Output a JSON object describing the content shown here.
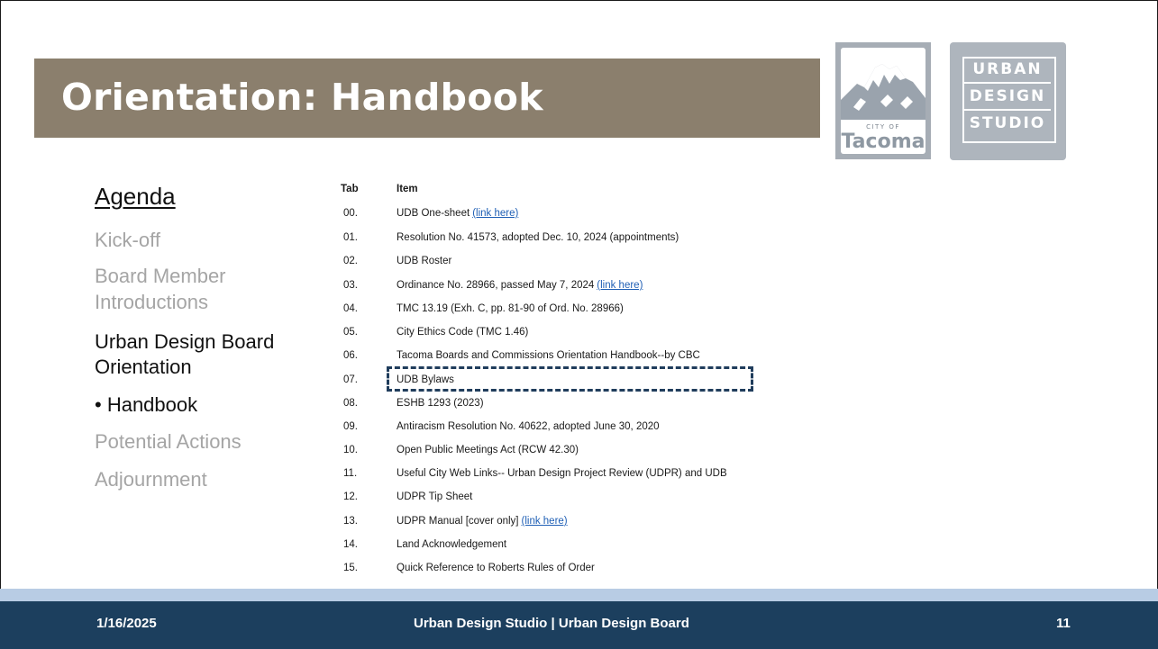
{
  "slide": {
    "title": "Orientation: Handbook",
    "colors": {
      "title_band": "#8b7f6d",
      "footer": "#1c3f5e",
      "footer_stripe": "#b8cce4",
      "link": "#1f5fb5",
      "highlight_box": "#203d5c"
    }
  },
  "logos": {
    "tacoma": {
      "city_text": "CITY OF",
      "name_text": "Tacoma"
    },
    "uds": {
      "line1": "URBAN",
      "line2": "DESIGN",
      "line3": "STUDIO"
    }
  },
  "agenda": {
    "heading": "Agenda",
    "items": [
      {
        "text": "Kick-off",
        "state": "dim"
      },
      {
        "text": "Board Member",
        "state": "dim"
      },
      {
        "text": "Introductions",
        "state": "dim"
      },
      {
        "text": "Urban Design Board",
        "state": "active"
      },
      {
        "text": "Orientation",
        "state": "active"
      },
      {
        "text": "• Handbook",
        "state": "active"
      },
      {
        "text": "Potential Actions",
        "state": "dim"
      },
      {
        "text": "Adjournment",
        "state": "dim"
      }
    ]
  },
  "table": {
    "headers": {
      "tab": "Tab",
      "item": "Item"
    },
    "rows": [
      {
        "tab": "00.",
        "item": "UDB One-sheet",
        "link": "(link here)"
      },
      {
        "tab": "01.",
        "item": "Resolution No. 41573, adopted Dec. 10, 2024 (appointments)"
      },
      {
        "tab": "02.",
        "item": "UDB Roster"
      },
      {
        "tab": "03.",
        "item": "Ordinance No. 28966, passed May 7, 2024",
        "link": "(link here)"
      },
      {
        "tab": "04.",
        "item": "TMC 13.19 (Exh. C, pp. 81-90 of Ord. No. 28966)"
      },
      {
        "tab": "05.",
        "item": "City Ethics Code (TMC 1.46)"
      },
      {
        "tab": "06.",
        "item": "Tacoma Boards and Commissions Orientation Handbook--by CBC"
      },
      {
        "tab": "07.",
        "item": "UDB Bylaws",
        "highlighted": true
      },
      {
        "tab": "08.",
        "item": "ESHB 1293 (2023)"
      },
      {
        "tab": "09.",
        "item": "Antiracism Resolution No. 40622, adopted June 30, 2020"
      },
      {
        "tab": "10.",
        "item": "Open Public Meetings Act (RCW 42.30)"
      },
      {
        "tab": "11.",
        "item": "Useful City Web Links-- Urban Design Project Review (UDPR) and UDB"
      },
      {
        "tab": "12.",
        "item": "UDPR Tip Sheet"
      },
      {
        "tab": "13.",
        "item": "UDPR Manual [cover only]",
        "link": "(link here)"
      },
      {
        "tab": "14.",
        "item": "Land Acknowledgement"
      },
      {
        "tab": "15.",
        "item": "Quick Reference to Roberts Rules of Order"
      }
    ]
  },
  "footer": {
    "date": "1/16/2025",
    "center": "Urban Design Studio | Urban Design Board",
    "page": "11"
  }
}
